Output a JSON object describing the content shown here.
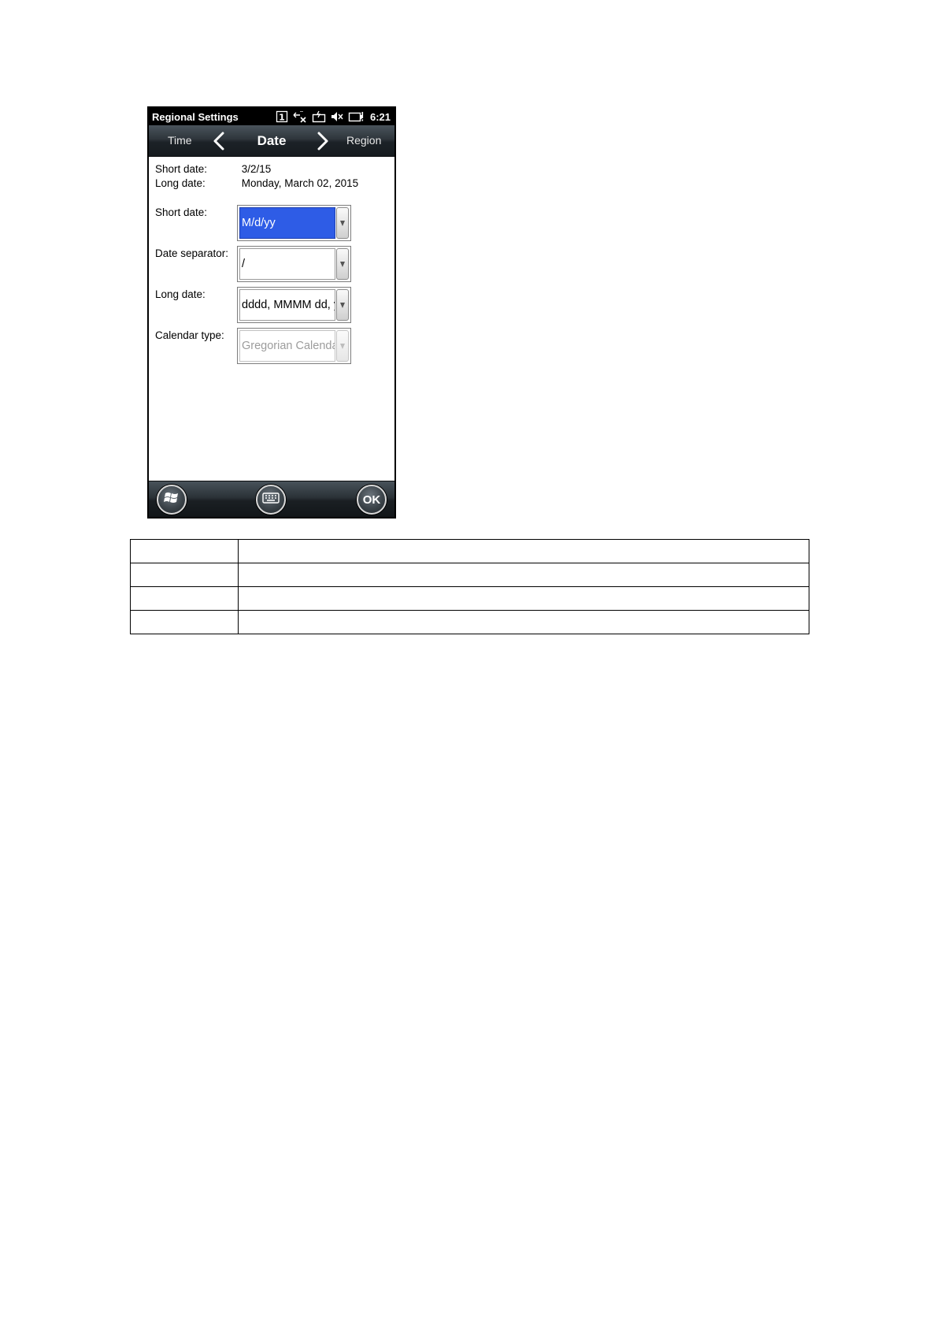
{
  "statusbar": {
    "title": "Regional Settings",
    "icons": [
      "channel-1-icon",
      "network-disconnected-icon",
      "battery-charging-icon",
      "speaker-muted-icon",
      "battery-icon"
    ],
    "channel_label": "1",
    "time": "6:21"
  },
  "navbar": {
    "prev_label": "Time",
    "title": "Date",
    "next_label": "Region"
  },
  "preview": {
    "short_date_label": "Short date:",
    "short_date_value": "3/2/15",
    "long_date_label": "Long date:",
    "long_date_value": "Monday, March 02, 2015"
  },
  "fields": {
    "short_date": {
      "label": "Short date:",
      "value": "M/d/yy",
      "state": "selected"
    },
    "date_separator": {
      "label": "Date separator:",
      "value": "/",
      "state": "normal"
    },
    "long_date": {
      "label": "Long date:",
      "value": "dddd, MMMM dd, yyyy",
      "state": "normal"
    },
    "calendar_type": {
      "label": "Calendar type:",
      "value": "Gregorian Calendar",
      "state": "disabled"
    }
  },
  "bottombar": {
    "icons": [
      "windows-start-icon",
      "keyboard-icon"
    ],
    "ok_label": "OK"
  },
  "colors": {
    "selection": "#2e5ce6",
    "status_bar": "#000000",
    "nav_bar": "#2e353b"
  },
  "table": {
    "rows": [
      [
        "",
        ""
      ],
      [
        "",
        ""
      ],
      [
        "",
        ""
      ],
      [
        "",
        ""
      ]
    ]
  }
}
